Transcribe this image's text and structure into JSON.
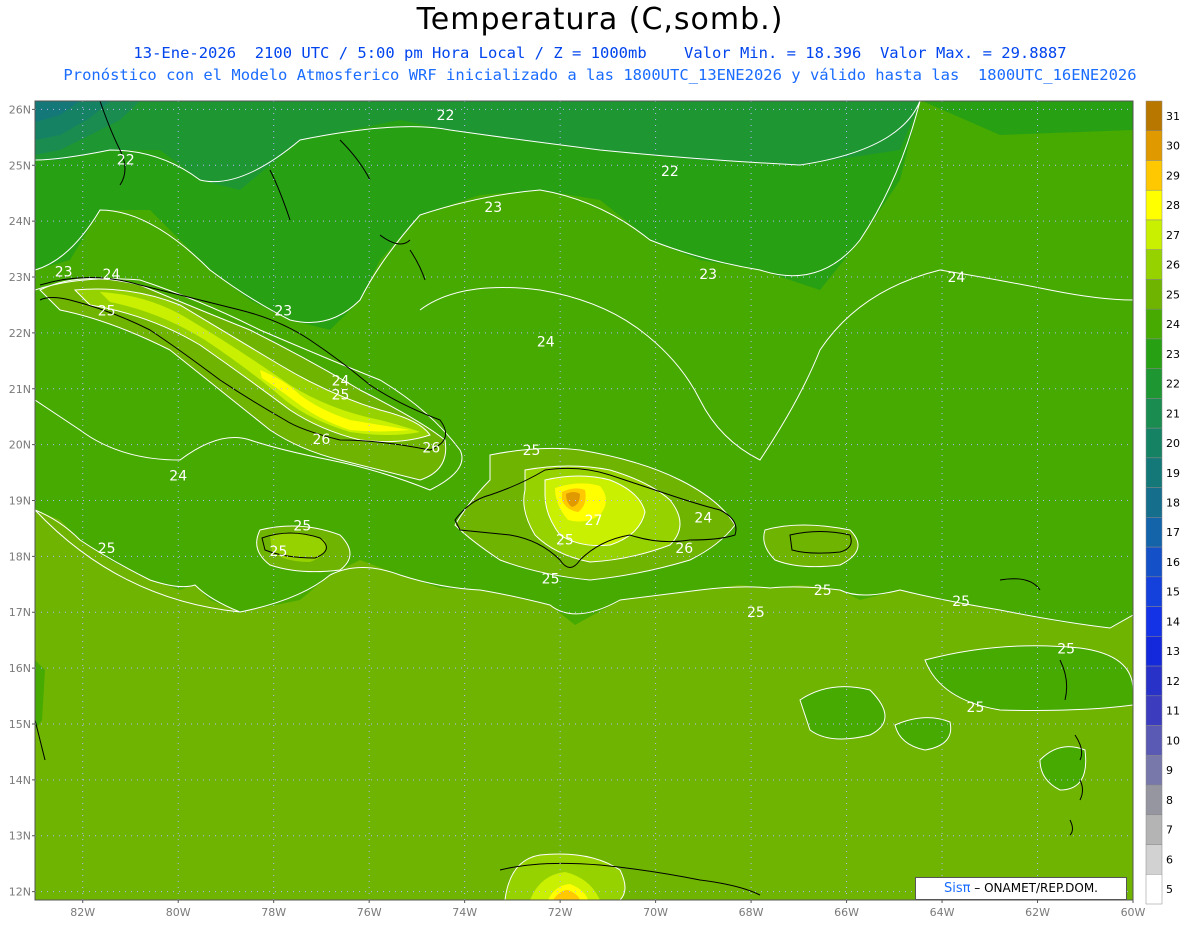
{
  "title": "Temperatura (C,somb.)",
  "subtitle1": "13-Ene-2026  2100 UTC / 5:00 pm Hora Local / Z = 1000mb    Valor Min. = 18.396  Valor Max. = 29.8887",
  "subtitle2": "Pronóstico con el Modelo Atmosferico WRF inicializado a las 1800UTC_13ENE2026 y válido hasta las  1800UTC_16ENE2026",
  "credit": {
    "brand": "Sisπ",
    "org": "– ONAMET/REP.DOM."
  },
  "lat_labels": [
    "26N",
    "25N",
    "24N",
    "23N",
    "22N",
    "21N",
    "20N",
    "19N",
    "18N",
    "17N",
    "16N",
    "15N",
    "14N",
    "13N",
    "12N"
  ],
  "lon_labels": [
    "82W",
    "80W",
    "78W",
    "76W",
    "74W",
    "72W",
    "70W",
    "68W",
    "66W",
    "64W",
    "62W",
    "60W"
  ],
  "colorbar": {
    "values": [
      "31",
      "30",
      "29",
      "28",
      "27",
      "26",
      "25",
      "24",
      "23",
      "22",
      "21",
      "20",
      "19",
      "18",
      "17",
      "16",
      "15",
      "14",
      "13",
      "12",
      "11",
      "10",
      "9",
      "8",
      "7",
      "6",
      "5"
    ],
    "colors": [
      "#b87800",
      "#e09a00",
      "#ffc800",
      "#ffff00",
      "#c8f000",
      "#96d200",
      "#6eb400",
      "#46aa00",
      "#28a014",
      "#1e9632",
      "#1a8c50",
      "#168264",
      "#147878",
      "#146e8c",
      "#1464aa",
      "#1450c8",
      "#1440dc",
      "#1432e6",
      "#1428dc",
      "#2832c8",
      "#3c3cbe",
      "#5a5ab4",
      "#7878aa",
      "#9696a0",
      "#b4b4b4",
      "#d2d2d2",
      "#ffffff"
    ]
  },
  "contour_labels": [
    {
      "text": "22",
      "lon": -74.4,
      "lat": 25.9
    },
    {
      "text": "22",
      "lon": -81.1,
      "lat": 25.1
    },
    {
      "text": "22",
      "lon": -69.7,
      "lat": 24.9
    },
    {
      "text": "23",
      "lon": -73.4,
      "lat": 24.25
    },
    {
      "text": "23",
      "lon": -82.4,
      "lat": 23.1
    },
    {
      "text": "24",
      "lon": -81.4,
      "lat": 23.05
    },
    {
      "text": "23",
      "lon": -68.9,
      "lat": 23.05
    },
    {
      "text": "24",
      "lon": -63.7,
      "lat": 23.0
    },
    {
      "text": "25",
      "lon": -81.5,
      "lat": 22.4
    },
    {
      "text": "23",
      "lon": -77.8,
      "lat": 22.4
    },
    {
      "text": "24",
      "lon": -72.3,
      "lat": 21.85
    },
    {
      "text": "24",
      "lon": -76.6,
      "lat": 21.15
    },
    {
      "text": "25",
      "lon": -76.6,
      "lat": 20.9
    },
    {
      "text": "26",
      "lon": -77.0,
      "lat": 20.1
    },
    {
      "text": "26",
      "lon": -74.7,
      "lat": 19.95
    },
    {
      "text": "25",
      "lon": -72.6,
      "lat": 19.9
    },
    {
      "text": "24",
      "lon": -80.0,
      "lat": 19.45
    },
    {
      "text": "27",
      "lon": -71.3,
      "lat": 18.65
    },
    {
      "text": "25",
      "lon": -71.9,
      "lat": 18.3
    },
    {
      "text": "24",
      "lon": -69.0,
      "lat": 18.7
    },
    {
      "text": "25",
      "lon": -77.4,
      "lat": 18.55
    },
    {
      "text": "25",
      "lon": -77.9,
      "lat": 18.1
    },
    {
      "text": "25",
      "lon": -81.5,
      "lat": 18.15
    },
    {
      "text": "26",
      "lon": -69.4,
      "lat": 18.15
    },
    {
      "text": "25",
      "lon": -72.2,
      "lat": 17.6
    },
    {
      "text": "25",
      "lon": -66.5,
      "lat": 17.4
    },
    {
      "text": "25",
      "lon": -67.9,
      "lat": 17.0
    },
    {
      "text": "25",
      "lon": -63.6,
      "lat": 17.2
    },
    {
      "text": "25",
      "lon": -61.4,
      "lat": 16.35
    },
    {
      "text": "25",
      "lon": -63.3,
      "lat": 15.3
    }
  ]
}
